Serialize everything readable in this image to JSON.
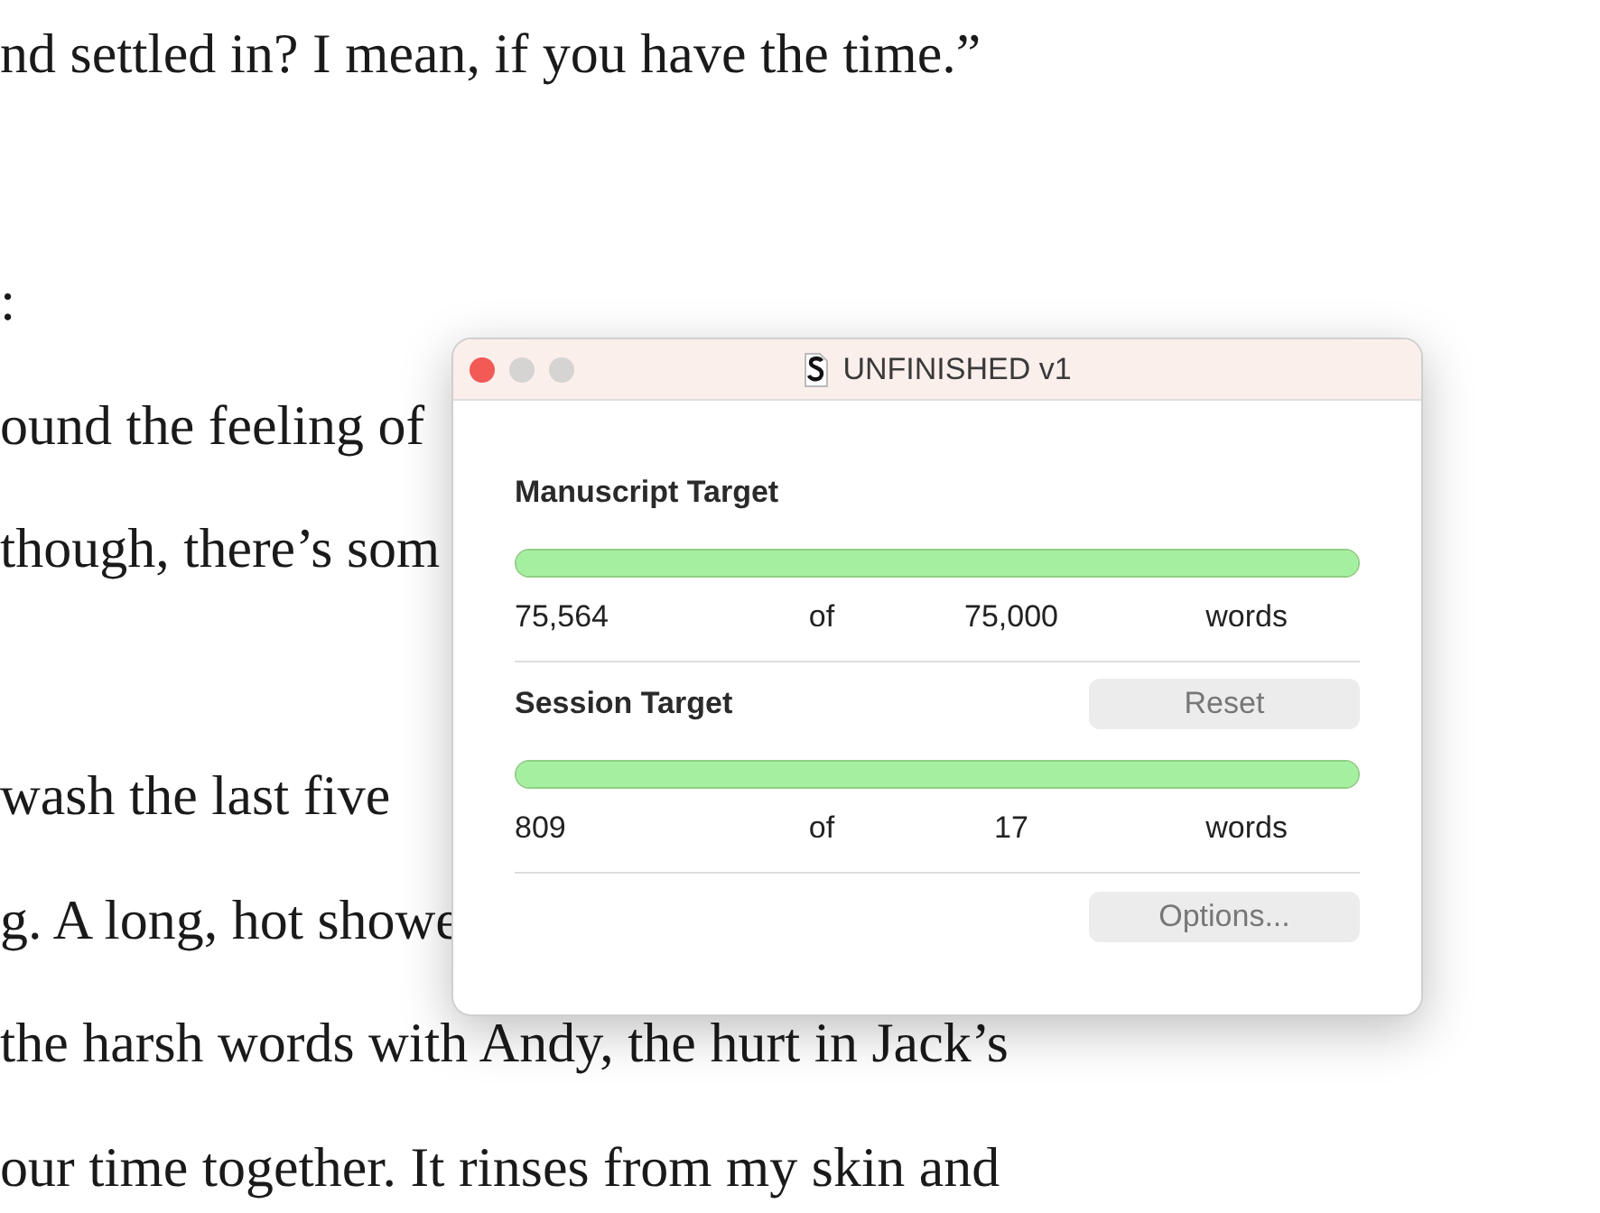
{
  "document": {
    "paragraphs": [
      {
        "lines": [
          "nd settled in? I mean, if you have the time.”"
        ]
      },
      {
        "lines": [
          ":",
          "ound the feeling of",
          "though, there’s som"
        ]
      },
      {
        "lines": [
          "wash the last five",
          "g. A long, hot showe",
          "the harsh words with Andy, the hurt in Jack’s",
          "our time together. It rinses from my skin and"
        ]
      }
    ]
  },
  "window": {
    "title": "UNFINISHED v1",
    "targets": [
      {
        "heading": "Manuscript Target",
        "level": 1,
        "current": "75,564",
        "of": "of",
        "goal": "75,000",
        "unit": "words"
      },
      {
        "heading": "Session Target",
        "button": "Reset",
        "level": 1,
        "current": "809",
        "of": "of",
        "goal": "17",
        "unit": "words"
      }
    ],
    "buttons": [
      "Options..."
    ]
  }
}
